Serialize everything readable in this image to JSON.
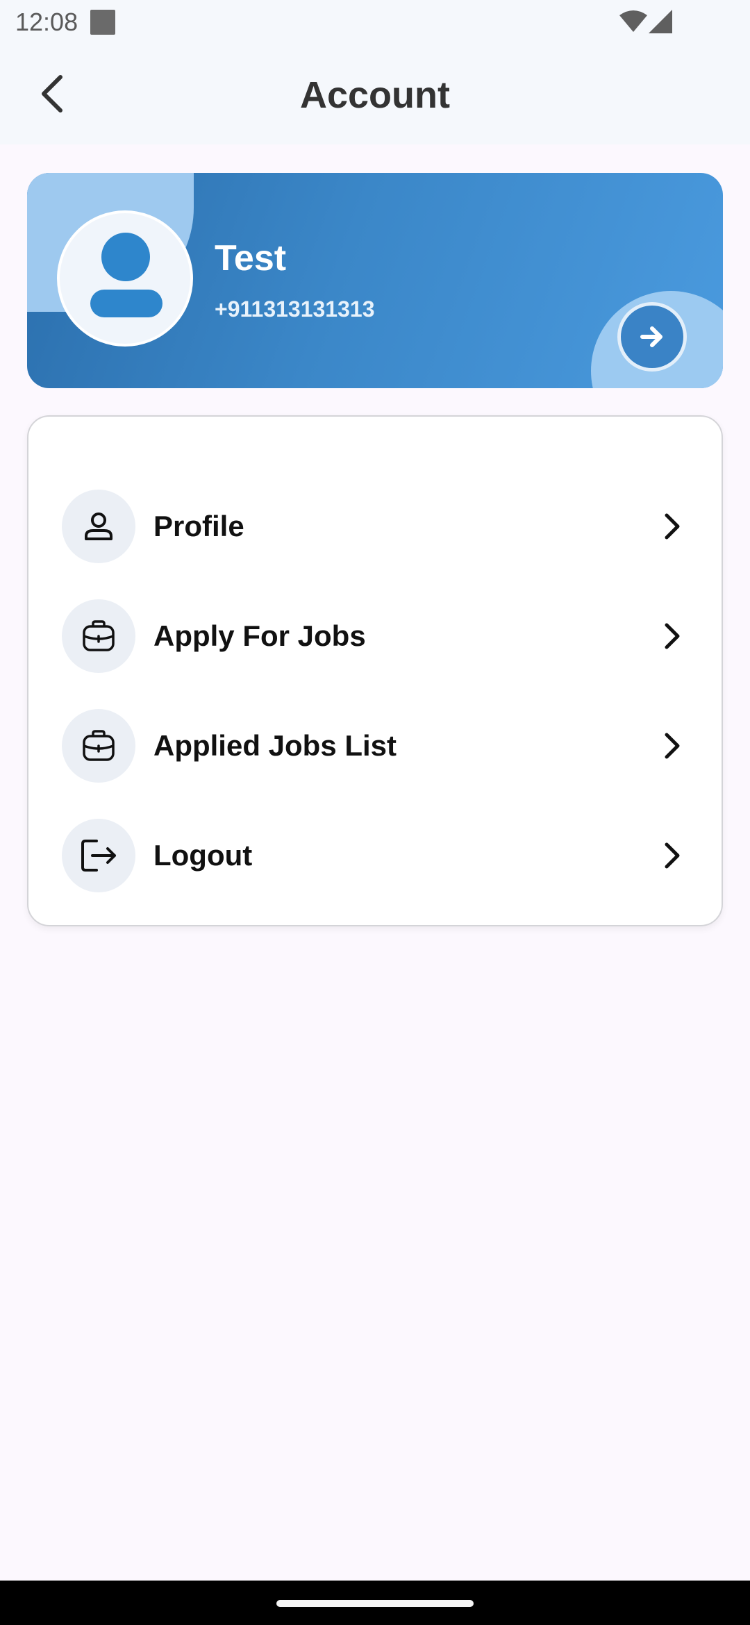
{
  "status_bar": {
    "time": "12:08"
  },
  "header": {
    "title": "Account",
    "back_icon": "chevron-left-icon"
  },
  "profile": {
    "name": "Test",
    "phone": "+911313131313",
    "avatar_icon": "person-avatar-icon",
    "action_icon": "arrow-right-icon"
  },
  "menu": {
    "items": [
      {
        "label": "Profile",
        "icon": "person-icon"
      },
      {
        "label": "Apply For Jobs",
        "icon": "briefcase-icon"
      },
      {
        "label": "Applied Jobs List",
        "icon": "briefcase-icon"
      },
      {
        "label": "Logout",
        "icon": "logout-icon"
      }
    ]
  },
  "colors": {
    "card_gradient_start": "#2b6fad",
    "card_gradient_end": "#4a9ade",
    "accent_blue": "#2e86cc",
    "icon_circle_bg": "#ebeff5",
    "page_bg": "#fcf8fe"
  }
}
